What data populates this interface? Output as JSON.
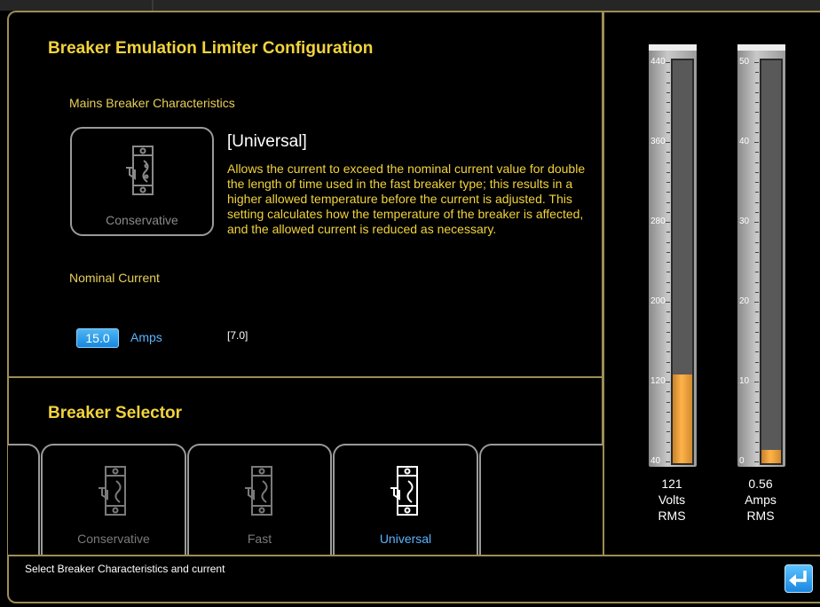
{
  "config": {
    "title": "Breaker Emulation Limiter Configuration",
    "mains_label": "Mains Breaker Characteristics",
    "current_breaker_caption": "Conservative",
    "description_heading": "[Universal]",
    "description_text": "Allows the current to exceed the nominal current value for double the length of time used in the fast breaker type; this results in a higher allowed temperature before the current is adjusted. This setting calculates how the temperature of the breaker is affected, and the allowed current is reduced as necessary.",
    "nominal_label": "Nominal Current",
    "nominal_value": "15.0",
    "nominal_unit": "Amps",
    "range_hint": "[7.0]"
  },
  "selector": {
    "title": "Breaker Selector",
    "options": [
      {
        "label": "Conservative",
        "selected": false
      },
      {
        "label": "Fast",
        "selected": false
      },
      {
        "label": "Universal",
        "selected": true
      }
    ]
  },
  "status": {
    "text": "Select Breaker Characteristics and current",
    "enter_icon": "enter-arrow-icon"
  },
  "meters": {
    "volts": {
      "ticks": [
        "440",
        "360",
        "280",
        "200",
        "120",
        "40"
      ],
      "min": 40,
      "max": 440,
      "level": 121,
      "value": "121",
      "unit": "Volts",
      "type": "RMS"
    },
    "amps": {
      "ticks": [
        "50",
        "40",
        "30",
        "20",
        "10",
        "0"
      ],
      "min": 0,
      "max": 50,
      "level": 0.56,
      "value": "0.56",
      "unit": "Amps",
      "type": "RMS"
    }
  },
  "colors": {
    "accent_gold": "#f2d33c",
    "border_gold": "#9e8d55",
    "selected_blue": "#59b4ff",
    "fill_orange": "#ffb34a"
  }
}
